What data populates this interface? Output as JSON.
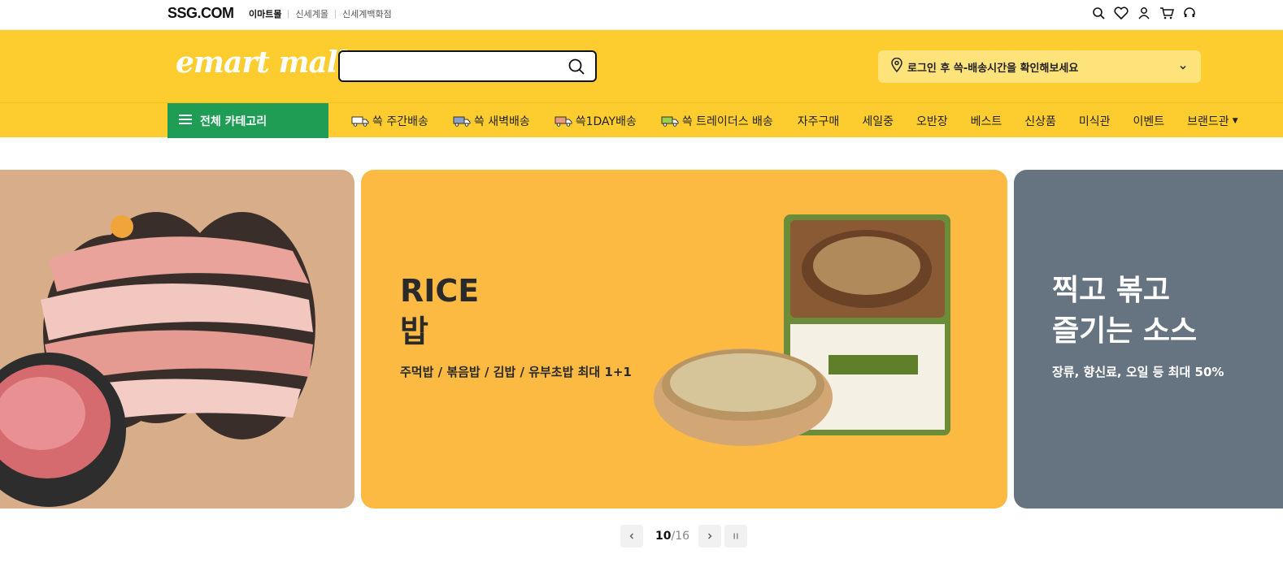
{
  "topbar": {
    "logo": "SSG.COM",
    "malls": [
      "이마트몰",
      "신세계몰",
      "신세계백화점"
    ],
    "icons": [
      "search-icon",
      "heart-icon",
      "user-icon",
      "cart-icon",
      "headset-icon"
    ]
  },
  "header": {
    "brand": "emart mall",
    "search_placeholder": "",
    "delivery_text": "로그인 후 쓱-배송시간을 확인해보세요"
  },
  "nav": {
    "all_category": "전체 카테고리",
    "items": [
      {
        "label": "쓱 주간배송",
        "truck_color": "#ffffff"
      },
      {
        "label": "쓱 새벽배송",
        "truck_color": "#8aa0c8"
      },
      {
        "label": "쓱1DAY배송",
        "truck_color": "#e99a7a"
      },
      {
        "label": "쓱 트레이더스 배송",
        "truck_color": "#9ecf4a"
      },
      {
        "label": "자주구매"
      },
      {
        "label": "세일중"
      },
      {
        "label": "오반장"
      },
      {
        "label": "베스트"
      },
      {
        "label": "신상품"
      },
      {
        "label": "미식관"
      },
      {
        "label": "이벤트"
      },
      {
        "label": "브랜드관"
      }
    ]
  },
  "carousel": {
    "mid": {
      "title_line1": "RICE",
      "title_line2": "밥",
      "subtitle": "주먹밥 / 볶음밥 / 김밥 / 유부초밥 최대 1+1",
      "bg": "#FCBA42"
    },
    "right": {
      "title_line1": "찍고 볶고",
      "title_line2": "즐기는 소스",
      "subtitle": "장류, 향신료, 오일 등 최대 50%",
      "bg": "#667380"
    },
    "left": {
      "bg": "#D7AE89"
    },
    "current": "10",
    "total": "/16"
  },
  "colors": {
    "accent": "#FDCD30",
    "category_green": "#1F9D55"
  }
}
